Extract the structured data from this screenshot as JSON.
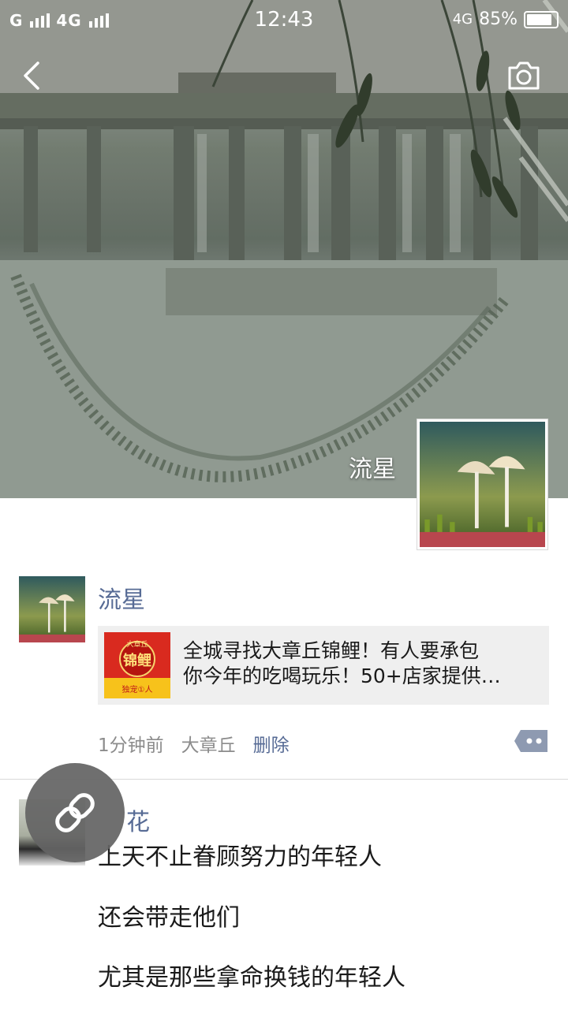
{
  "status_bar": {
    "signal_left": "G",
    "network2": "4G",
    "time": "12:43",
    "network_badge": "4G",
    "battery_percent": "85%",
    "battery_level": 0.85
  },
  "cover": {
    "name": "流星"
  },
  "post": {
    "author": "流星",
    "link_title_line1": "全城寻找大章丘锦鲤！有人要承包",
    "link_title_line2": "你今年的吃喝玩乐！50+店家提供…",
    "thumb_text_top": "大章丘",
    "thumb_text_main": "锦鲤",
    "thumb_text_bottom": "独宠①人",
    "time_ago": "1分钟前",
    "location": "大章丘",
    "delete_label": "删除"
  },
  "post2": {
    "author_partial": "花",
    "lines": [
      "上天不止眷顾努力的年轻人",
      "还会带走他们",
      "尤其是那些拿命换钱的年轻人"
    ]
  },
  "icons": {
    "back": "chevron-left-icon",
    "camera": "camera-icon",
    "comment": "comment-dots-icon",
    "link": "link-icon"
  },
  "colors": {
    "link_blue": "#576b95",
    "card_bg": "#efefef",
    "meta_gray": "#8c8c8c"
  }
}
